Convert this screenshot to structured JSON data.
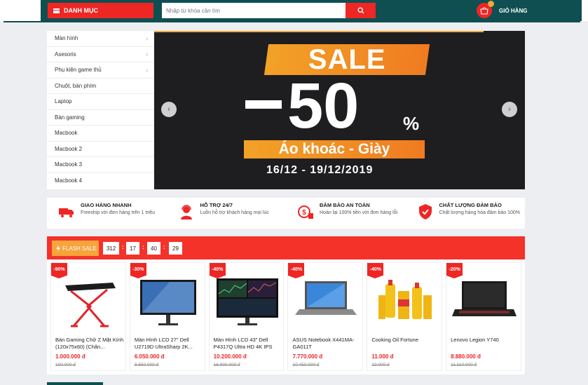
{
  "header": {
    "category_label": "DANH MỤC",
    "search_placeholder": "Nhập từ khóa cần tìm",
    "cart_label": "GIỎ HÀNG"
  },
  "sidebar": {
    "items": [
      {
        "label": "Màn hình",
        "has_submenu": true
      },
      {
        "label": "Asesoris",
        "has_submenu": true
      },
      {
        "label": "Phụ kiện game thủ",
        "has_submenu": true
      },
      {
        "label": "Chuột, bàn phím",
        "has_submenu": false
      },
      {
        "label": "Laptop",
        "has_submenu": false
      },
      {
        "label": "Bàn gaming",
        "has_submenu": false
      },
      {
        "label": "Macbook",
        "has_submenu": false
      },
      {
        "label": "Macbook 2",
        "has_submenu": false
      },
      {
        "label": "Macbook 3",
        "has_submenu": false
      },
      {
        "label": "Macbook 4",
        "has_submenu": false
      }
    ]
  },
  "banner": {
    "sale": "SALE",
    "discount": "50",
    "percent": "%",
    "subtitle": "Áo khoác - Giày",
    "dates": "16/12 - 19/12/2019"
  },
  "services": [
    {
      "icon": "truck-icon",
      "title": "GIAO HÀNG NHANH",
      "desc": "Freeship với đơn hàng trên 1 triệu"
    },
    {
      "icon": "support-agent-icon",
      "title": "HỖ TRỢ 24/7",
      "desc": "Luôn hỗ trợ khách hàng mọi lúc"
    },
    {
      "icon": "money-back-icon",
      "title": "ĐẢM BẢO AN TOÀN",
      "desc": "Hoàn lại 100% tiền với đơn hàng lỗi"
    },
    {
      "icon": "shield-check-icon",
      "title": "CHẤT LƯỢNG ĐẢM BẢO",
      "desc": "Chất lượng hàng hóa đảm bảo 100%"
    }
  ],
  "flash_sale": {
    "label": "FLASH SALE",
    "timer": [
      "312",
      "17",
      "40",
      "29"
    ]
  },
  "products": [
    {
      "discount": "-90%",
      "name": "Bàn Gaming Chữ Z Mặt Kính (120x75x60) (Chân...",
      "price": "1.000.000 đ",
      "old_price": "100.000 đ",
      "image": "gaming-desk"
    },
    {
      "discount": "-30%",
      "name": "Màn Hình LCD 27\" Dell U2719D UltraSharp 2K...",
      "price": "6.050.000 đ",
      "old_price": "8.650.000 đ",
      "image": "monitor"
    },
    {
      "discount": "-40%",
      "name": "Màn Hình LCD 43\" Dell P4317Q Ultra HD 4K IPS",
      "price": "10.200.000 đ",
      "old_price": "16.900.000 đ",
      "image": "monitor-large"
    },
    {
      "discount": "-40%",
      "name": "ASUS Notebook X441MA-GA011T",
      "price": "7.770.000 đ",
      "old_price": "10.450.000 đ",
      "image": "laptop"
    },
    {
      "discount": "-40%",
      "name": "Cooking Oil Fortune",
      "price": "11.000 đ",
      "old_price": "22.000 đ",
      "image": "oil-bottles"
    },
    {
      "discount": "-20%",
      "name": "Lenovo Legion Y740",
      "price": "8.880.000 đ",
      "old_price": "11.110.000 đ",
      "image": "gaming-laptop"
    }
  ],
  "colors": {
    "primary_red": "#ee2624",
    "header_teal": "#0f4f52",
    "accent_orange": "#f2a838",
    "banner_bg": "#1e1e20"
  }
}
